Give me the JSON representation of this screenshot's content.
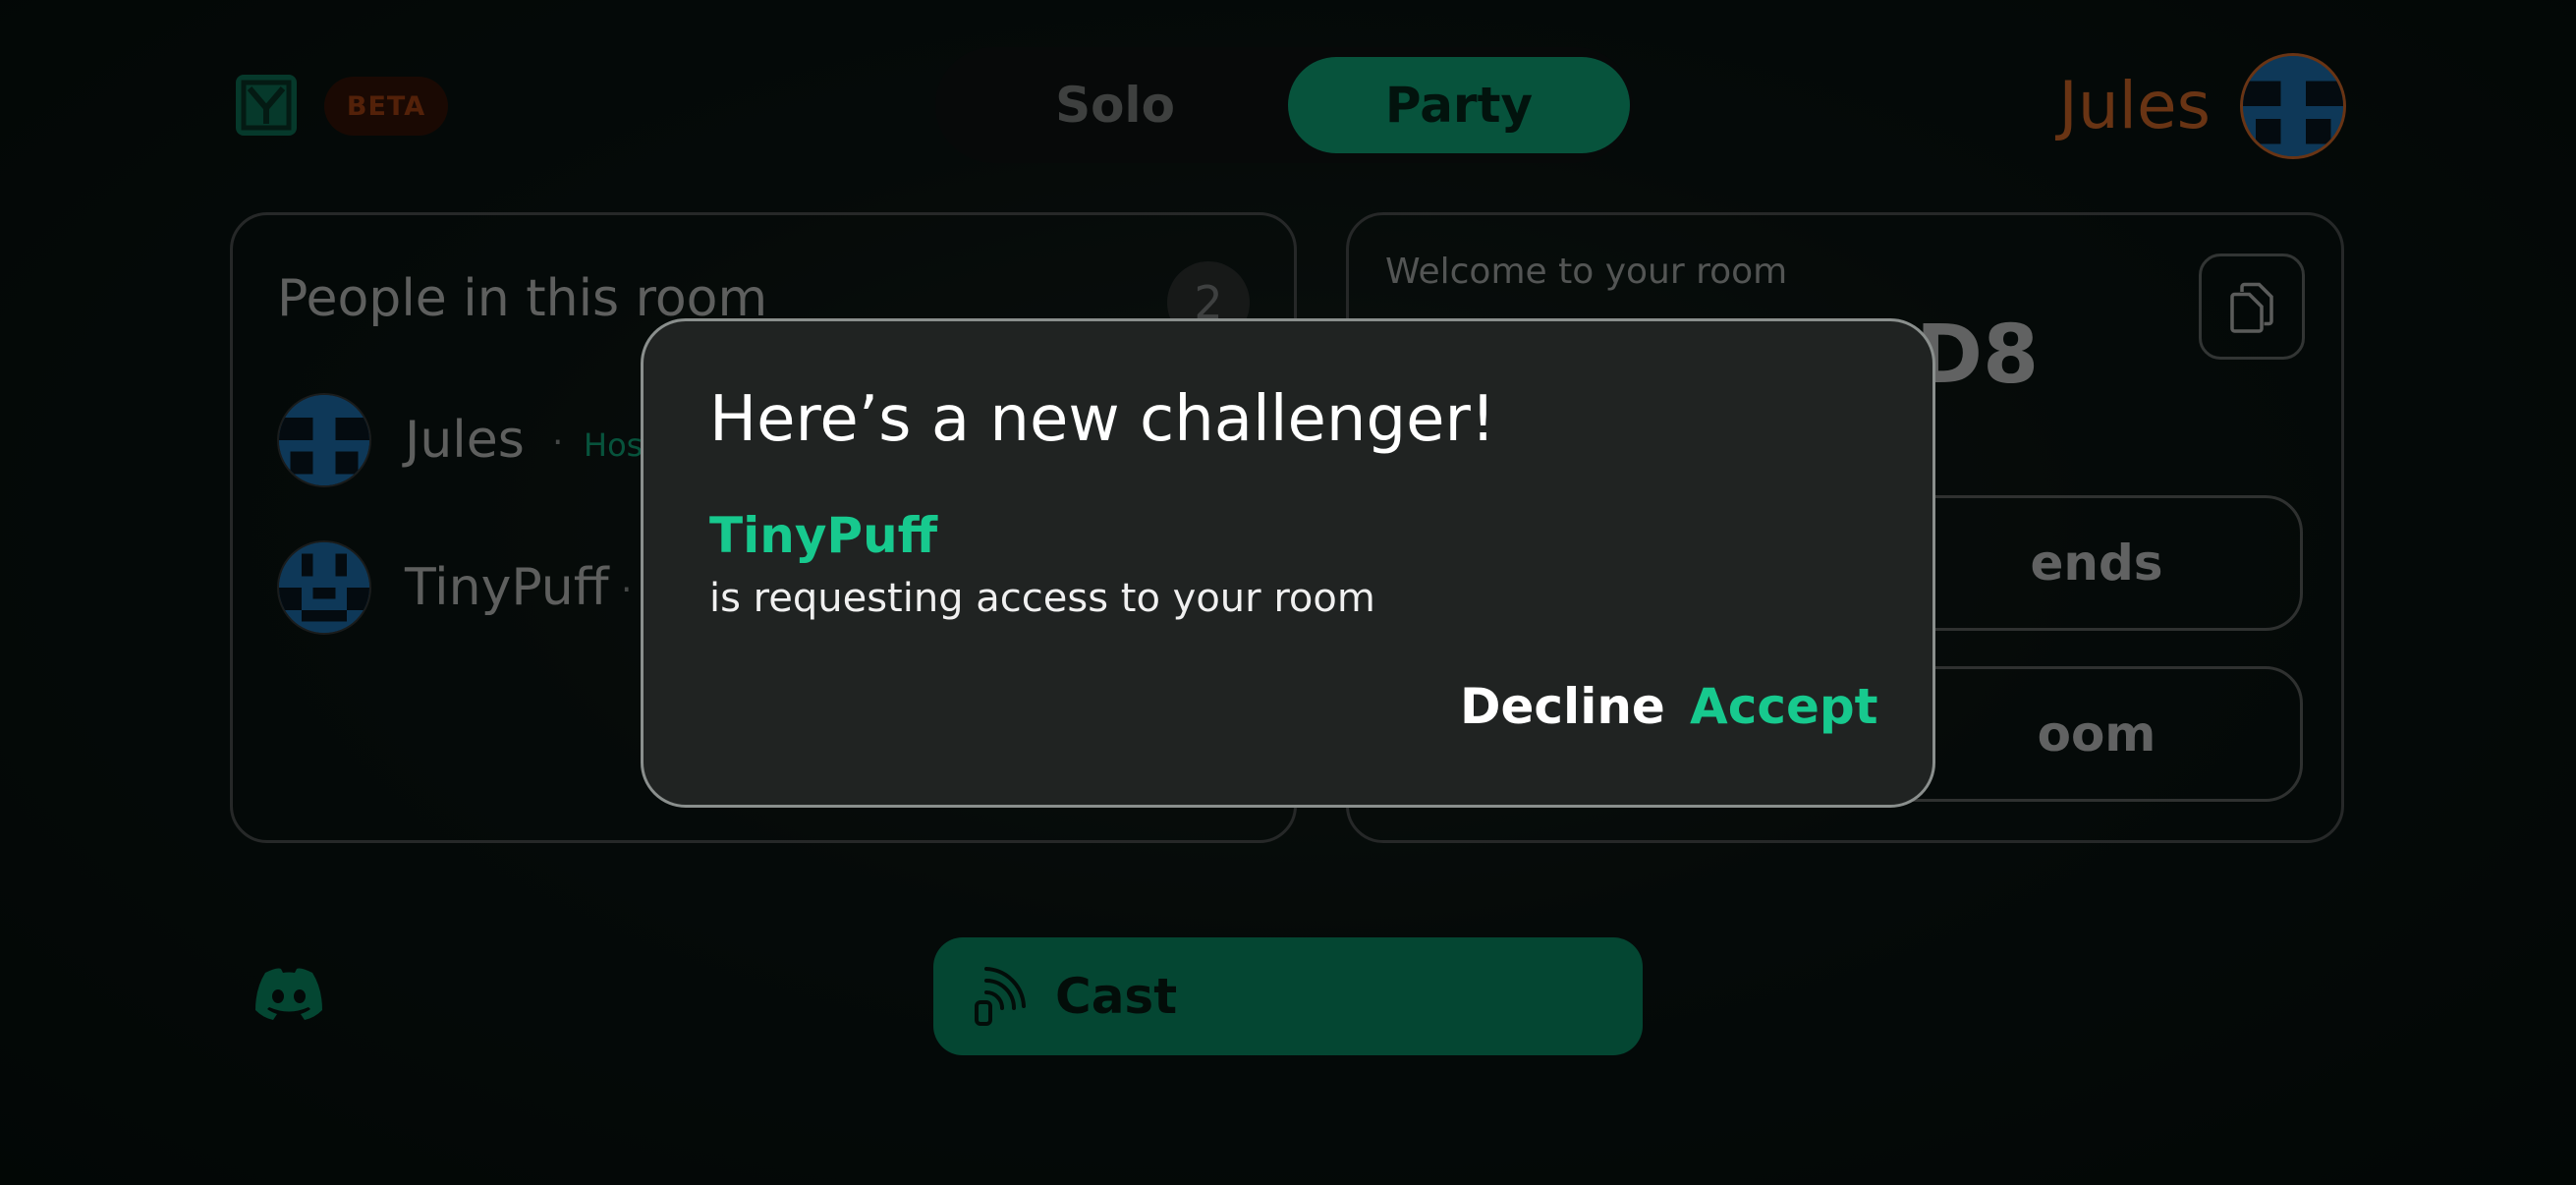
{
  "header": {
    "logo_icon": "app-logo-icon",
    "beta_badge": "BETA",
    "modes": [
      {
        "label": "Solo",
        "selected": false
      },
      {
        "label": "Party",
        "selected": true
      }
    ],
    "user_name": "Jules"
  },
  "people_panel": {
    "title": "People in this room",
    "count": "2",
    "members": [
      {
        "name": "Jules",
        "role": "Host"
      },
      {
        "name": "TinyPuff",
        "role": ""
      }
    ]
  },
  "room_panel": {
    "welcome": "Welcome to your room",
    "code_visible_suffix": "D8",
    "copy_icon": "copy-icon",
    "buttons": [
      {
        "label_visible": "ends"
      },
      {
        "label_visible": "oom"
      }
    ]
  },
  "footer": {
    "discord_icon": "discord-icon",
    "cast_label": "Cast",
    "cast_icon": "cast-icon"
  },
  "modal": {
    "title": "Here’s a new challenger!",
    "requester": "TinyPuff",
    "message": "is requesting access to your room",
    "decline_label": "Decline",
    "accept_label": "Accept"
  },
  "colors": {
    "accent": "#10b886",
    "accent_text": "#17c98e",
    "user_orange": "#e8732e",
    "modal_bg": "#202322"
  }
}
